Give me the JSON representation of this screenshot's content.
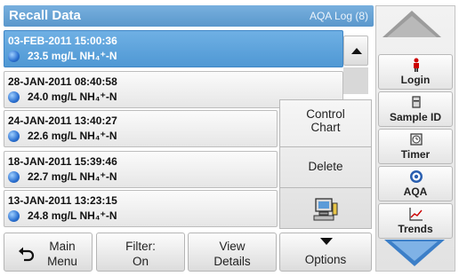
{
  "header": {
    "title": "Recall Data",
    "log": "AQA Log (8)"
  },
  "records": [
    {
      "date": "03-FEB-2011 15:00:36",
      "value": "23.5 mg/L NH₄⁺-N"
    },
    {
      "date": "28-JAN-2011 08:40:58",
      "value": "24.0 mg/L NH₄⁺-N"
    },
    {
      "date": "24-JAN-2011 13:40:27",
      "value": "22.6 mg/L NH₄⁺-N"
    },
    {
      "date": "18-JAN-2011 15:39:46",
      "value": "22.7 mg/L NH₄⁺-N"
    },
    {
      "date": "13-JAN-2011 13:23:15",
      "value": "24.8 mg/L NH₄⁺-N"
    }
  ],
  "popup": {
    "control_chart_1": "Control",
    "control_chart_2": "Chart",
    "delete": "Delete"
  },
  "bottom": {
    "main_menu_1": "Main",
    "main_menu_2": "Menu",
    "filter_1": "Filter:",
    "filter_2": "On",
    "view_1": "View",
    "view_2": "Details",
    "options": "Options"
  },
  "sidebar": {
    "login": "Login",
    "sample_id": "Sample ID",
    "timer": "Timer",
    "aqa": "AQA",
    "trends": "Trends"
  },
  "colors": {
    "accent": "#5a97cc",
    "selected": "#4f98d4",
    "arrow": "#3c7fc8"
  },
  "icons": {
    "globe": "globe-icon",
    "computer": "computer-icon",
    "back": "back-arrow-icon",
    "login": "person-icon",
    "sample": "sample-container-icon",
    "timer": "timer-icon",
    "aqa": "target-icon",
    "trends": "trend-chart-icon"
  }
}
